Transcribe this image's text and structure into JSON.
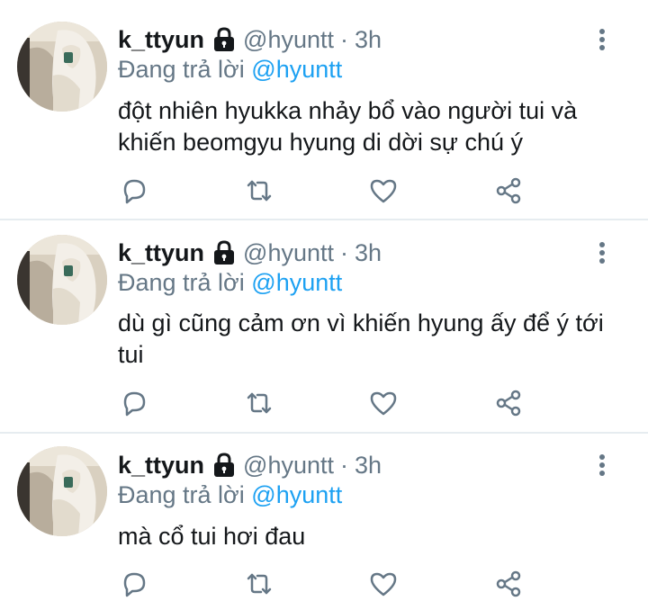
{
  "accent_color": "#1da1f2",
  "secondary_text_color": "#657786",
  "tweets": [
    {
      "name": "k_ttyun",
      "handle": "@hyuntt",
      "separator": "·",
      "time": "3h",
      "reply_prefix": "Đang trả lời",
      "reply_to": "@hyuntt",
      "text": "đột nhiên hyukka nhảy bổ vào người tui và khiến beomgyu hyung di dời sự chú ý"
    },
    {
      "name": "k_ttyun",
      "handle": "@hyuntt",
      "separator": "·",
      "time": "3h",
      "reply_prefix": "Đang trả lời",
      "reply_to": "@hyuntt",
      "text": "dù gì cũng cảm ơn vì khiến hyung ấy để ý tới tui"
    },
    {
      "name": "k_ttyun",
      "handle": "@hyuntt",
      "separator": "·",
      "time": "3h",
      "reply_prefix": "Đang trả lời",
      "reply_to": "@hyuntt",
      "text": "mà cổ tui hơi đau"
    }
  ],
  "icons": {
    "protected": "lock-icon",
    "more": "more-vertical-icon",
    "reply": "reply-icon",
    "retweet": "retweet-icon",
    "like": "heart-icon",
    "share": "share-icon"
  }
}
